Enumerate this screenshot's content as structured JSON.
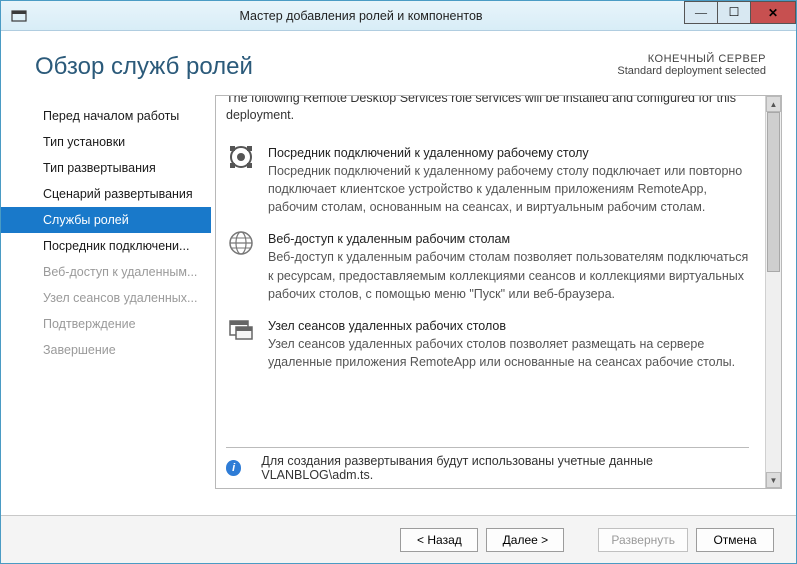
{
  "window": {
    "title": "Мастер добавления ролей и компонентов"
  },
  "header": {
    "title": "Обзор служб ролей",
    "target_label": "КОНЕЧНЫЙ СЕРВЕР",
    "deployment": "Standard deployment selected"
  },
  "nav": {
    "items": [
      {
        "label": "Перед началом работы",
        "state": "normal"
      },
      {
        "label": "Тип установки",
        "state": "normal"
      },
      {
        "label": "Тип развертывания",
        "state": "normal"
      },
      {
        "label": "Сценарий развертывания",
        "state": "normal"
      },
      {
        "label": "Службы ролей",
        "state": "selected"
      },
      {
        "label": "Посредник подключени...",
        "state": "normal"
      },
      {
        "label": "Веб-доступ к удаленным...",
        "state": "disabled"
      },
      {
        "label": "Узел сеансов удаленных...",
        "state": "disabled"
      },
      {
        "label": "Подтверждение",
        "state": "disabled"
      },
      {
        "label": "Завершение",
        "state": "disabled"
      }
    ]
  },
  "content": {
    "intro": "The following Remote Desktop Services role services will be installed and configured for this deployment.",
    "roles": [
      {
        "name": "Посредник подключений к удаленному рабочему столу",
        "desc": "Посредник подключений к удаленному рабочему столу подключает или повторно подключает клиентское устройство к удаленным приложениям RemoteApp, рабочим столам, основанным на сеансах, и виртуальным рабочим столам."
      },
      {
        "name": "Веб-доступ к удаленным рабочим столам",
        "desc": "Веб-доступ к удаленным рабочим столам позволяет пользователям подключаться к ресурсам, предоставляемым коллекциями сеансов и коллекциями виртуальных рабочих столов, с помощью меню \"Пуск\" или веб-браузера."
      },
      {
        "name": "Узел сеансов удаленных рабочих столов",
        "desc": "Узел сеансов удаленных рабочих столов позволяет размещать на сервере удаленные приложения RemoteApp или основанные на сеансах рабочие столы."
      }
    ],
    "footer_note": "Для создания развертывания будут использованы учетные данные VLANBLOG\\adm.ts."
  },
  "buttons": {
    "back": "< Назад",
    "next": "Далее >",
    "deploy": "Развернуть",
    "cancel": "Отмена"
  }
}
